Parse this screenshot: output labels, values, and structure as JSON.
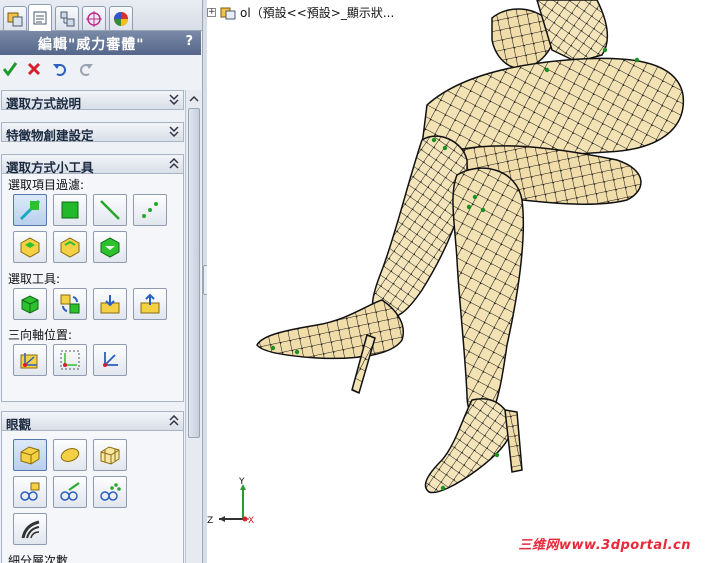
{
  "property_manager": {
    "tabs": [
      {
        "name": "feature-manager-tab",
        "icon": "feature-tree-icon"
      },
      {
        "name": "property-manager-tab",
        "icon": "property-manager-icon"
      },
      {
        "name": "configuration-manager-tab",
        "icon": "configuration-icon"
      },
      {
        "name": "dimxpert-manager-tab",
        "icon": "crosshair-icon"
      },
      {
        "name": "display-manager-tab",
        "icon": "appearance-icon"
      }
    ],
    "title": "編輯\"威力審體\"",
    "help": "?",
    "actions": {
      "ok_icon": "checkmark-icon",
      "cancel_icon": "x-icon",
      "undo_icon": "undo-icon",
      "redo_icon": "redo-icon"
    },
    "sections": {
      "selection_help": "選取方式說明",
      "feature_create": "特徵物創建設定",
      "selection_tools": "選取方式小工具",
      "eye": "眼觀"
    },
    "selection_filter_label": "選取項目過濾:",
    "selection_tool_label": "選取工具:",
    "triad_label": "三向軸位置:",
    "subdivision_label": "細分層次數"
  },
  "viewport": {
    "tree_label": "ol（預設<<預設>_顯示狀...",
    "watermark": "三维网www.3dportal.cn",
    "triad": {
      "x": "X",
      "y": "Y",
      "z": "Z"
    }
  },
  "colors": {
    "title_bar": "#5a6b8e",
    "mesh_fill": "#f3e2b3",
    "mesh_line": "#1b1b1b",
    "ok_green": "#1e9a2c",
    "cancel_red": "#d6202b",
    "watermark_red": "#e8293a"
  }
}
